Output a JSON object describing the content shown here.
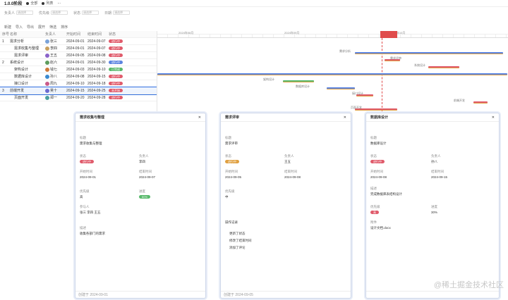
{
  "topbar": {
    "title": "1.0.0阶段",
    "chip1": "全部",
    "chip2": "列表"
  },
  "filters": [
    {
      "label": "负责人",
      "placeholder": "请选择"
    },
    {
      "label": "优先级",
      "placeholder": "请选择"
    },
    {
      "label": "状态",
      "placeholder": "请选择"
    },
    {
      "label": "日期",
      "placeholder": "请选择"
    }
  ],
  "toolbar": [
    "新建",
    "导入",
    "导出",
    "展开",
    "筛选",
    "排序"
  ],
  "grid": {
    "headers": [
      "序号",
      "名称",
      "负责人",
      "开始时间",
      "结束时间",
      "状态"
    ],
    "rows": [
      {
        "no": "1",
        "name": "需求分析",
        "owner": "张三",
        "start": "2024-09-01",
        "end": "2024-09-07",
        "status": "进行中",
        "scolor": "#e05b6b",
        "avcolor": "#7aa3d9",
        "sel": false
      },
      {
        "no": "",
        "name": "需求收集与整理",
        "owner": "李四",
        "start": "2024-09-01",
        "end": "2024-09-07",
        "status": "进行中",
        "scolor": "#e05b6b",
        "avcolor": "#c9a05e",
        "sel": false
      },
      {
        "no": "",
        "name": "需求评审",
        "owner": "王五",
        "start": "2024-09-05",
        "end": "2024-09-08",
        "status": "进行中",
        "scolor": "#e05b6b",
        "avcolor": "#8a63c9",
        "sel": false
      },
      {
        "no": "2",
        "name": "系统设计",
        "owner": "赵六",
        "start": "2024-09-01",
        "end": "2024-09-30",
        "status": "进行中",
        "scolor": "#5b84e0",
        "avcolor": "#5e9d5e",
        "sel": false
      },
      {
        "no": "",
        "name": "架构设计",
        "owner": "钱七",
        "start": "2024-09-03",
        "end": "2024-09-10",
        "status": "已完成",
        "scolor": "#58b96b",
        "avcolor": "#d07a3a",
        "sel": false
      },
      {
        "no": "",
        "name": "数据库设计",
        "owner": "孙八",
        "start": "2024-09-08",
        "end": "2024-09-15",
        "status": "进行中",
        "scolor": "#e05b6b",
        "avcolor": "#3a8ad0",
        "sel": false
      },
      {
        "no": "",
        "name": "接口设计",
        "owner": "周九",
        "start": "2024-09-10",
        "end": "2024-09-18",
        "status": "进行中",
        "scolor": "#e05b6b",
        "avcolor": "#c95b8a",
        "sel": false
      },
      {
        "no": "3",
        "name": "前端开发",
        "owner": "吴十",
        "start": "2024-09-15",
        "end": "2024-09-25",
        "status": "未开始",
        "scolor": "#e05b6b",
        "avcolor": "#6b6bd0",
        "sel": true
      },
      {
        "no": "",
        "name": "页面开发",
        "owner": "郑一",
        "start": "2024-09-20",
        "end": "2024-09-28",
        "status": "进行中",
        "scolor": "#e05b6b",
        "avcolor": "#4aa0a0",
        "sel": false
      }
    ]
  },
  "gantt": {
    "months": [
      "2024年08月",
      "2024年09月",
      "2024年10月"
    ],
    "labels": [
      "需求分析",
      "需求评审",
      "系统设计",
      "架构设计",
      "数据库设计",
      "接口设计",
      "前端开发",
      "页面开发"
    ]
  },
  "panels": [
    {
      "title": "需求收集与整理",
      "fields": [
        {
          "label": "标题",
          "value": "需求收集与整理"
        },
        {
          "label": "状态",
          "value": "进行中"
        },
        {
          "label": "负责人",
          "value": "李四"
        },
        {
          "label": "开始时间",
          "value": "2024-09-01"
        },
        {
          "label": "结束时间",
          "value": "2024-09-07"
        },
        {
          "label": "优先级",
          "value": "高"
        },
        {
          "label": "进度",
          "value": "60%"
        },
        {
          "label": "参与人",
          "value": "张三 李四 王五"
        },
        {
          "label": "描述",
          "value": "收集各部门的需求"
        }
      ],
      "footer": "创建于 2024-09-01"
    },
    {
      "title": "需求评审",
      "fields": [
        {
          "label": "标题",
          "value": "需求评审"
        },
        {
          "label": "状态",
          "value": "进行中"
        },
        {
          "label": "负责人",
          "value": "王五"
        },
        {
          "label": "开始时间",
          "value": "2024-09-05"
        },
        {
          "label": "结束时间",
          "value": "2024-09-08"
        },
        {
          "label": "优先级",
          "value": "中"
        }
      ],
      "activity_title": "操作记录",
      "activities": [
        "更新了状态",
        "修改了结束时间",
        "添加了评论"
      ],
      "footer": "创建于 2024-09-05"
    },
    {
      "title": "数据库设计",
      "fields": [
        {
          "label": "标题",
          "value": "数据库设计"
        },
        {
          "label": "状态",
          "value": "进行中"
        },
        {
          "label": "负责人",
          "value": "孙八"
        },
        {
          "label": "开始时间",
          "value": "2024-09-08"
        },
        {
          "label": "结束时间",
          "value": "2024-09-15"
        },
        {
          "label": "描述",
          "value": "完成数据库表结构设计"
        },
        {
          "label": "优先级",
          "value": "高"
        },
        {
          "label": "进度",
          "value": "30%"
        },
        {
          "label": "附件",
          "value": "设计文档.docx"
        }
      ],
      "footer": ""
    }
  ],
  "watermark": "@稀土掘金技术社区"
}
